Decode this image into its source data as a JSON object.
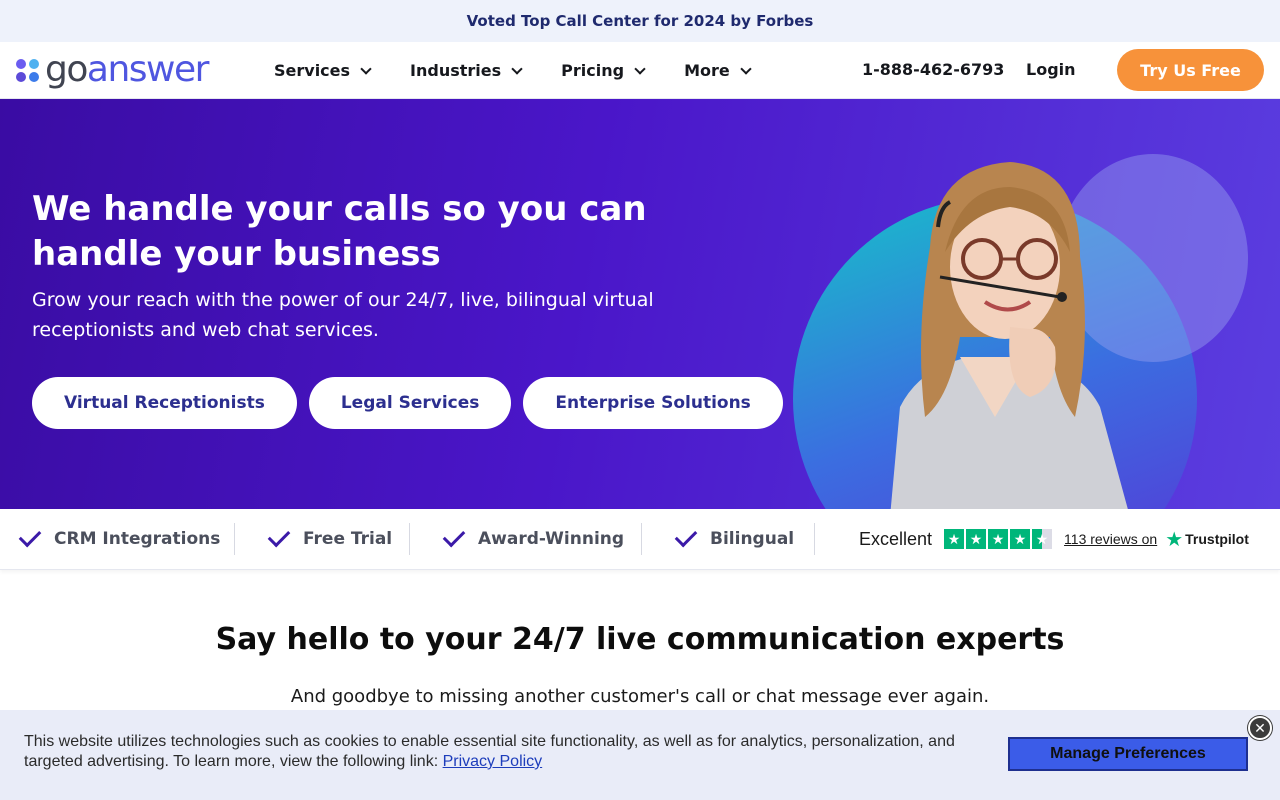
{
  "announcement": "Voted Top Call Center for 2024 by Forbes",
  "logo": {
    "go": "go",
    "answer": "answer",
    "dot_colors": [
      "#6a5cf0",
      "#4fb1f0",
      "#5c4ad8",
      "#3c7bea"
    ]
  },
  "nav": {
    "items": [
      {
        "label": "Services"
      },
      {
        "label": "Industries"
      },
      {
        "label": "Pricing"
      },
      {
        "label": "More"
      }
    ],
    "phone": "1-888-462-6793",
    "login": "Login",
    "cta": "Try Us Free"
  },
  "hero": {
    "title": "We handle your calls so you can handle your business",
    "subtitle": "Grow your reach with the power of our 24/7, live, bilingual virtual receptionists and web chat services.",
    "buttons": [
      "Virtual Receptionists",
      "Legal Services",
      "Enterprise Solutions"
    ]
  },
  "features": [
    "CRM Integrations",
    "Free Trial",
    "Award-Winning",
    "Bilingual"
  ],
  "trustpilot": {
    "rating_word": "Excellent",
    "stars": 4.5,
    "reviews": "113 reviews on",
    "brand": "Trustpilot"
  },
  "section": {
    "title": "Say hello to your 24/7 live communication experts",
    "subtitle": "And goodbye to missing another customer's call or chat message ever again."
  },
  "cookie": {
    "text": "This website utilizes technologies such as cookies to enable essential site functionality, as well as for analytics, personalization, and targeted advertising. To learn more, view the following link:",
    "link": "Privacy Policy",
    "button": "Manage Preferences",
    "close": "✕"
  },
  "colors": {
    "brand": "#4f56e0",
    "accent": "#f7923a",
    "hero": "#3a0ca3",
    "check": "#3b1aa8",
    "trustpilot": "#00b67a"
  }
}
